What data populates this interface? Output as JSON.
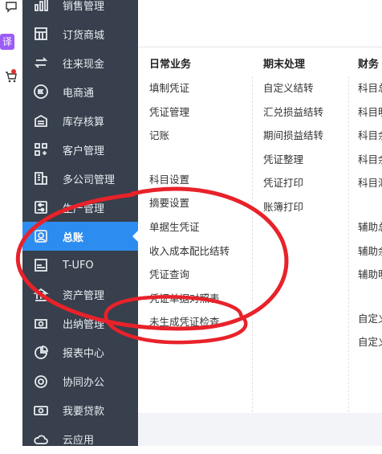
{
  "widgets": {
    "translate_label": "译"
  },
  "sidebar": {
    "items": [
      {
        "label": "销售管理",
        "icon": "chart-bars-icon"
      },
      {
        "label": "订货商城",
        "icon": "store-icon"
      },
      {
        "label": "往来现金",
        "icon": "exchange-arrows-icon"
      },
      {
        "label": "电商通",
        "icon": "e-circle-icon"
      },
      {
        "label": "库存核算",
        "icon": "warehouse-icon"
      },
      {
        "label": "客户管理",
        "icon": "grid-plus-icon"
      },
      {
        "label": "多公司管理",
        "icon": "building-icon"
      },
      {
        "label": "生产管理",
        "icon": "sliders-icon"
      },
      {
        "label": "总账",
        "icon": "ledger-icon",
        "active": true
      },
      {
        "label": "T-UFO",
        "icon": "ufo-doc-icon"
      },
      {
        "label": "资产管理",
        "icon": "bank-icon"
      },
      {
        "label": "出纳管理",
        "icon": "cash-icon"
      },
      {
        "label": "报表中心",
        "icon": "pie-chart-icon"
      },
      {
        "label": "协同办公",
        "icon": "collab-icon"
      },
      {
        "label": "我要贷款",
        "icon": "money-icon"
      },
      {
        "label": "云应用",
        "icon": "cloud-icon"
      }
    ]
  },
  "menu": {
    "columns": [
      {
        "header": "日常业务",
        "groups": [
          [
            "填制凭证",
            "凭证管理",
            "记账"
          ],
          [
            "科目设置",
            "摘要设置",
            "单据生凭证",
            "收入成本配比结转",
            "凭证查询",
            "凭证单据对照表",
            "未生成凭证检查"
          ]
        ]
      },
      {
        "header": "期末处理",
        "groups": [
          [
            "自定义结转",
            "汇兑损益结转",
            "期间损益结转",
            "凭证整理",
            "凭证打印",
            "账簿打印"
          ]
        ]
      },
      {
        "header": "财务",
        "groups": [
          [
            "科目总",
            "科目明",
            "科目余",
            "科目余",
            "科目汇"
          ],
          [
            "辅助总",
            "辅助余",
            "辅助明"
          ],
          [
            "自定义",
            "自定义"
          ]
        ]
      }
    ]
  }
}
